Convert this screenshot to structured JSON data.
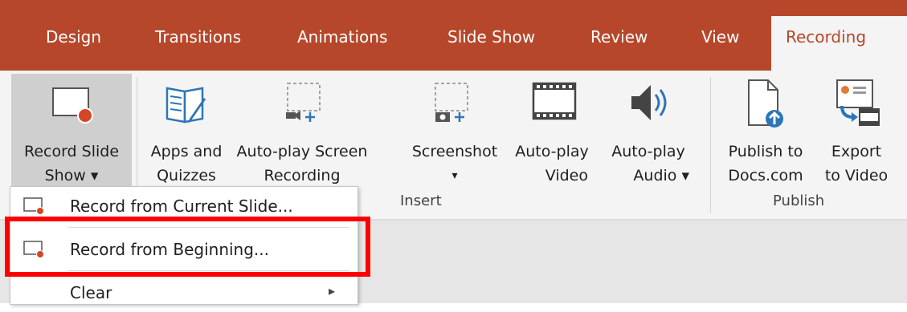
{
  "tabs": [
    "Design",
    "Transitions",
    "Animations",
    "Slide Show",
    "Review",
    "View"
  ],
  "active_tab": "Recording",
  "buttons": {
    "record_slide_show": [
      "Record Slide",
      "Show ▾"
    ],
    "apps_quizzes": [
      "Apps and",
      "Quizzes"
    ],
    "autoplay_screen_recording": [
      "Auto-play Screen",
      "Recording"
    ],
    "screenshot": [
      "Screenshot",
      "▾"
    ],
    "autoplay_video": [
      "Auto-play",
      "Video"
    ],
    "autoplay_audio": [
      "Auto-play",
      "Audio ▾"
    ],
    "publish_docs": [
      "Publish to",
      "Docs.com"
    ],
    "export_video": [
      "Export",
      "to Video"
    ]
  },
  "groups": {
    "insert": "Insert",
    "publish": "Publish"
  },
  "menu": {
    "items": [
      {
        "label": "Record from Current Slide..."
      },
      {
        "label": "Record from Beginning..."
      },
      {
        "label": "Clear"
      }
    ],
    "clear_arrow": "▸"
  },
  "accent_color": "#b7472a"
}
